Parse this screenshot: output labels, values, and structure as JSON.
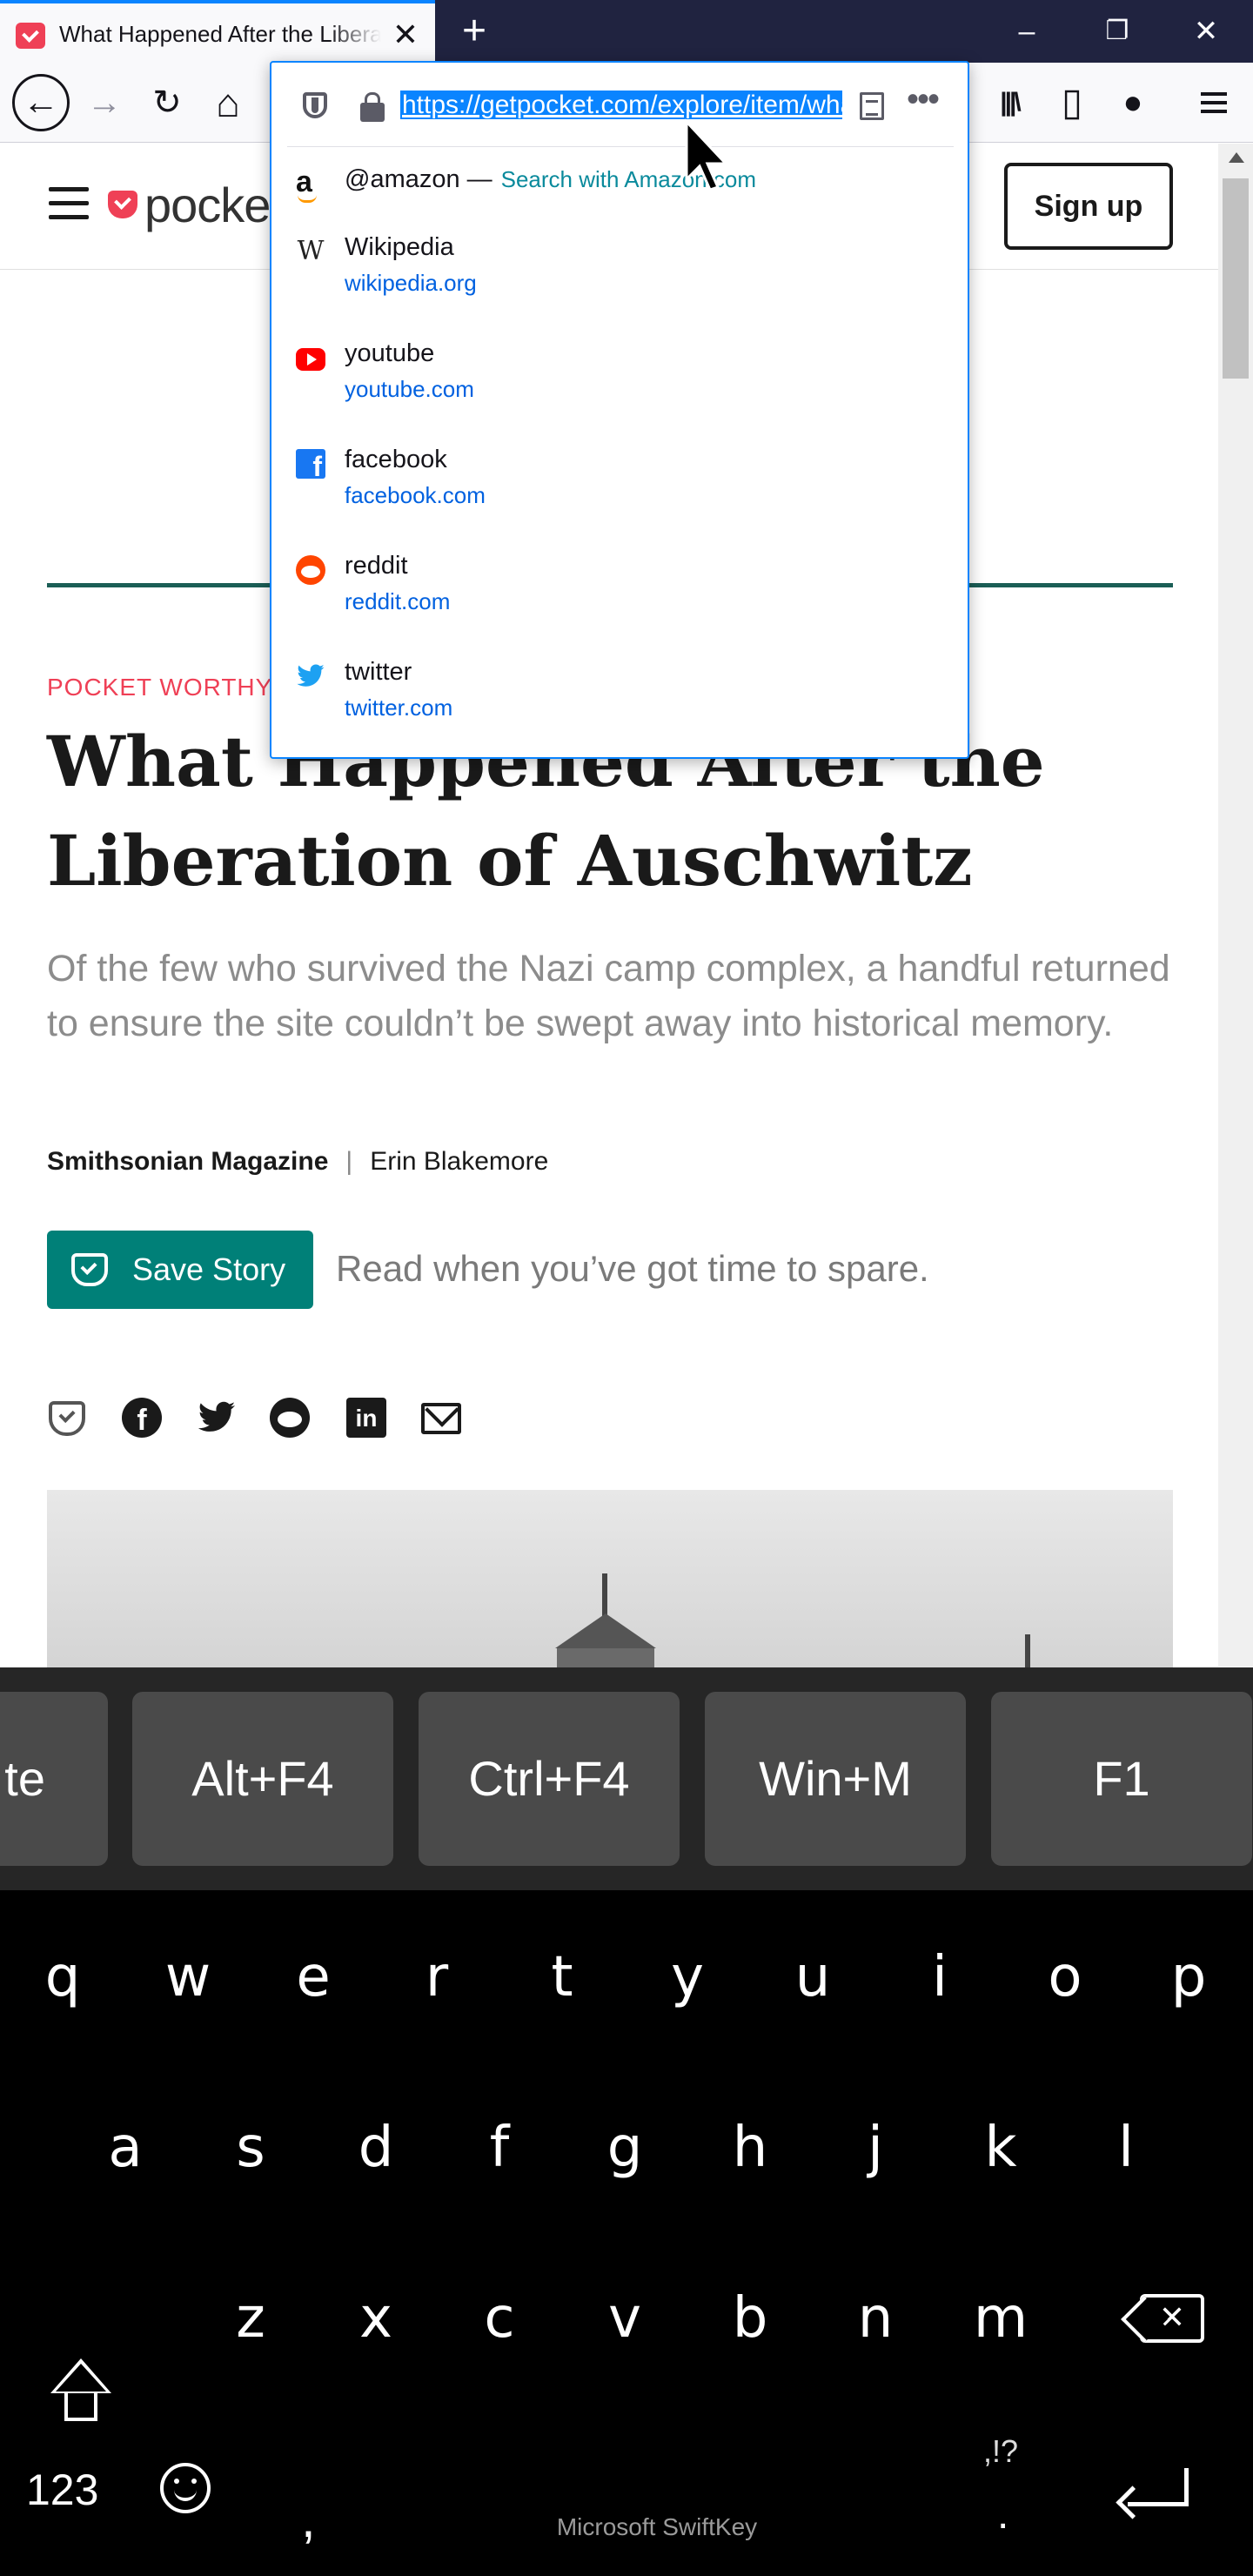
{
  "browser": {
    "tab_title": "What Happened After the Liberation of Auschwitz",
    "tab_close": "✕",
    "new_tab": "+",
    "window_controls": {
      "minimize": "–",
      "restore": "❐",
      "close": "✕"
    },
    "nav": {
      "back": "←",
      "forward": "→",
      "reload": "↻",
      "home": "⌂",
      "library": "|||\\",
      "sidebar": "▯",
      "account": "●"
    },
    "url": "https://getpocket.com/explore/item/what-happened-after-the-liberation-of-auschwitz",
    "more": "•••",
    "accent": "#0a84ff"
  },
  "suggestions": {
    "amazon": {
      "title": "@amazon",
      "dash": "—",
      "action": "Search with Amazon.com"
    },
    "items": [
      {
        "title": "Wikipedia",
        "url": "wikipedia.org",
        "icon": "wikipedia-icon",
        "glyph": "W"
      },
      {
        "title": "youtube",
        "url": "youtube.com",
        "icon": "youtube-icon"
      },
      {
        "title": "facebook",
        "url": "facebook.com",
        "icon": "facebook-icon",
        "glyph": "f"
      },
      {
        "title": "reddit",
        "url": "reddit.com",
        "icon": "reddit-icon"
      },
      {
        "title": "twitter",
        "url": "twitter.com",
        "icon": "twitter-icon",
        "glyph": "🐦"
      }
    ]
  },
  "page": {
    "logo_text": "pocket",
    "signup_label": "Sign up",
    "eyebrow": "POCKET WORTHY",
    "headline": "What Happened After the Liberation of Auschwitz",
    "dek": "Of the few who survived the Nazi camp complex, a handful returned to ensure the site couldn’t be swept away into historical memory.",
    "publication": "Smithsonian Magazine",
    "byline_sep": "|",
    "author": "Erin Blakemore",
    "save_label": "Save Story",
    "save_note": "Read when you’ve got time to spare.",
    "share_fb": "f",
    "share_li": "in",
    "brand_color": "#ef4056",
    "save_color": "#008078"
  },
  "keyboard": {
    "macros": [
      "te",
      "Alt+F4",
      "Ctrl+F4",
      "Win+M",
      "F1"
    ],
    "row1": [
      "q",
      "w",
      "e",
      "r",
      "t",
      "y",
      "u",
      "i",
      "o",
      "p"
    ],
    "row2": [
      "a",
      "s",
      "d",
      "f",
      "g",
      "h",
      "j",
      "k",
      "l"
    ],
    "row3": [
      "z",
      "x",
      "c",
      "v",
      "b",
      "n",
      "m"
    ],
    "numbers_key": "123",
    "comma_key": ",",
    "punct_hint": ",!?",
    "period_key": ".",
    "brand": "Microsoft SwiftKey"
  }
}
